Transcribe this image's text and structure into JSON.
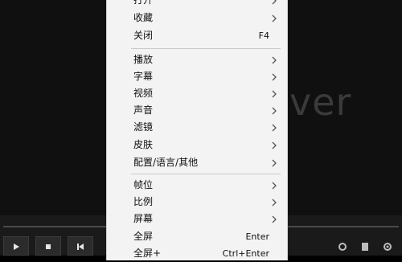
{
  "player": {
    "watermark": "ver"
  },
  "menu": {
    "items": [
      {
        "label": "打开",
        "shortcut": "",
        "submenu": true
      },
      {
        "label": "收藏",
        "shortcut": "",
        "submenu": true
      },
      {
        "label": "关闭",
        "shortcut": "F4",
        "submenu": false
      },
      {
        "label": "播放",
        "shortcut": "",
        "submenu": true
      },
      {
        "label": "字幕",
        "shortcut": "",
        "submenu": true
      },
      {
        "label": "视频",
        "shortcut": "",
        "submenu": true
      },
      {
        "label": "声音",
        "shortcut": "",
        "submenu": true
      },
      {
        "label": "滤镜",
        "shortcut": "",
        "submenu": true
      },
      {
        "label": "皮肤",
        "shortcut": "",
        "submenu": true
      },
      {
        "label": "配置/语言/其他",
        "shortcut": "",
        "submenu": true
      },
      {
        "label": "帧位",
        "shortcut": "",
        "submenu": true
      },
      {
        "label": "比例",
        "shortcut": "",
        "submenu": true
      },
      {
        "label": "屏幕",
        "shortcut": "",
        "submenu": true
      },
      {
        "label": "全屏",
        "shortcut": "Enter",
        "submenu": false
      },
      {
        "label": "全屏+",
        "shortcut": "Ctrl+Enter",
        "submenu": false
      }
    ]
  },
  "controls": {
    "icons": [
      "play-icon",
      "stop-icon",
      "previous-icon",
      "settings-icon"
    ]
  },
  "colors": {
    "menu_bg": "#f3f3f3",
    "player_bg": "#101010",
    "separator": "#c9c9c9"
  }
}
